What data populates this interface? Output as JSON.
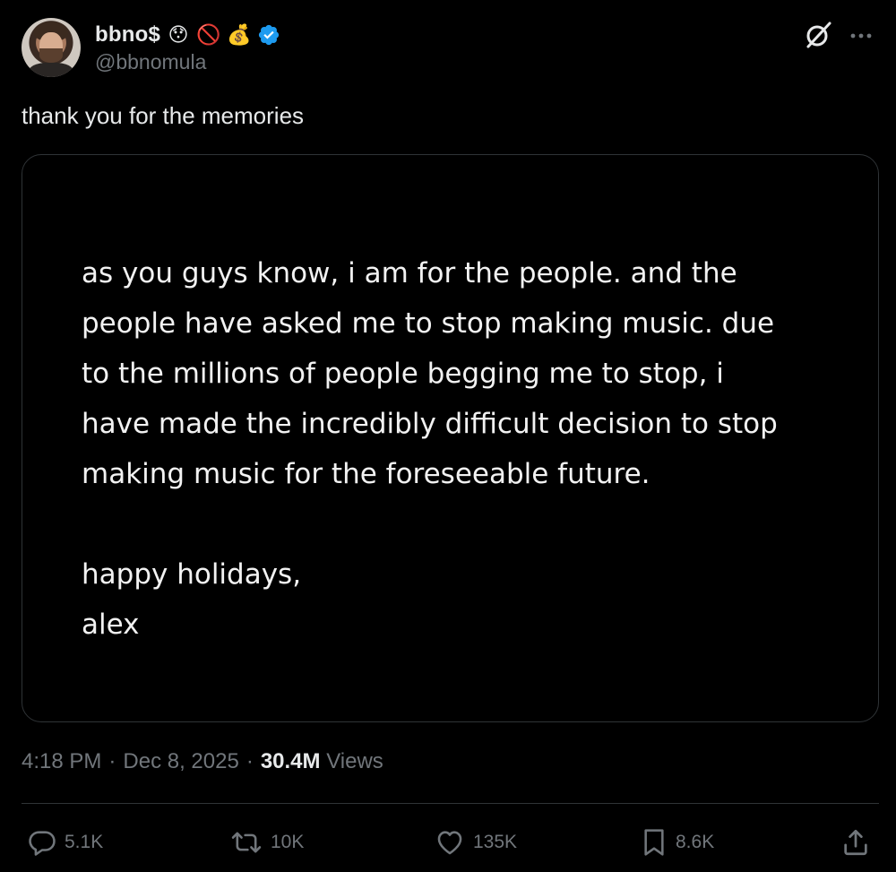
{
  "author": {
    "display_name": "bbno$",
    "emojis": [
      "😯",
      "🚫",
      "💰"
    ],
    "handle": "@bbnomula",
    "verified": true,
    "verified_color": "#1d9bf0"
  },
  "tweet": {
    "text": "thank you for the memories",
    "note_lines": [
      "as you guys know, i am for the people. and the",
      "people have asked me to stop making music. due",
      "to the millions of people begging me to stop, i",
      "have made the incredibly difficult decision to stop",
      "making music for the foreseeable future."
    ],
    "sign_off": [
      "happy holidays,",
      "alex"
    ]
  },
  "meta": {
    "time": "4:18 PM",
    "separator": "·",
    "date": "Dec 8, 2025",
    "views_count": "30.4M",
    "views_label": "Views"
  },
  "actions": {
    "replies": "5.1K",
    "reposts": "10K",
    "likes": "135K",
    "bookmarks": "8.6K"
  },
  "icons": {
    "grok": "grok-icon",
    "more": "more-icon",
    "reply": "reply-icon",
    "repost": "repost-icon",
    "like": "heart-icon",
    "bookmark": "bookmark-icon",
    "share": "share-icon"
  },
  "colors": {
    "background": "#000000",
    "text": "#e7e9ea",
    "muted": "#71767b",
    "border": "#2f3336"
  }
}
